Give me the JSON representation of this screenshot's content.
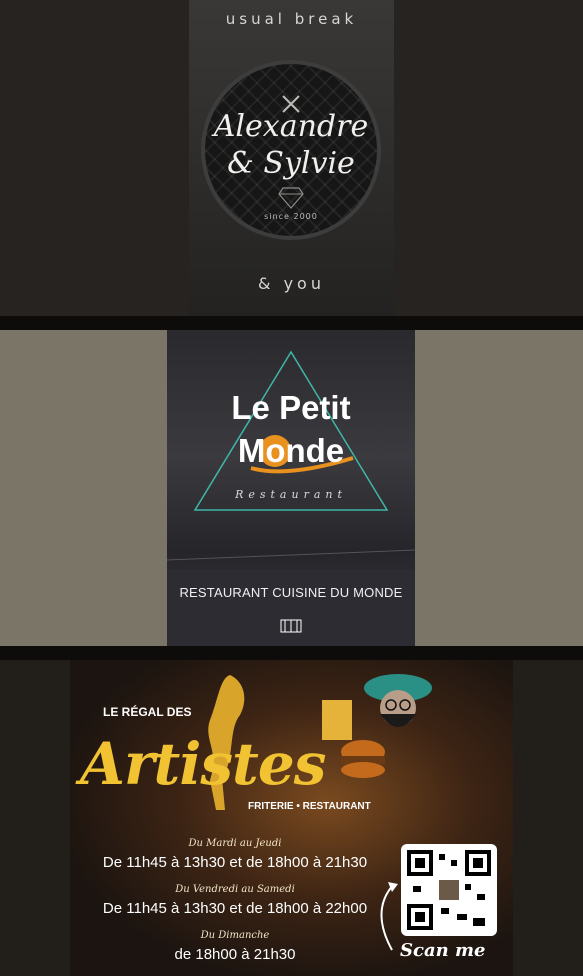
{
  "card1": {
    "top_text": "usual break",
    "name_line1": "Alexandre",
    "name_line2": "& Sylvie",
    "since": "since 2000",
    "bottom_text": "& you"
  },
  "card2": {
    "title_line1": "Le Petit",
    "title_line2": "Monde",
    "subtitle": "Restaurant",
    "tagline": "RESTAURANT CUISINE DU MONDE"
  },
  "card3": {
    "pre_title": "LE RÉGAL DES",
    "title": "Artistes",
    "subtitle": "FRITERIE • RESTAURANT",
    "schedule": [
      {
        "day": "Du Mardi au Jeudi",
        "hours": "De 11h45 à 13h30 et de 18h00 à 21h30"
      },
      {
        "day": "Du Vendredi au Samedi",
        "hours": "De 11h45 à 13h30 et de 18h00 à 22h00"
      },
      {
        "day": "Du Dimanche",
        "hours": "de 18h00 à 21h30"
      }
    ],
    "scan_label": "Scan me",
    "accent_color": "#f1c232"
  }
}
